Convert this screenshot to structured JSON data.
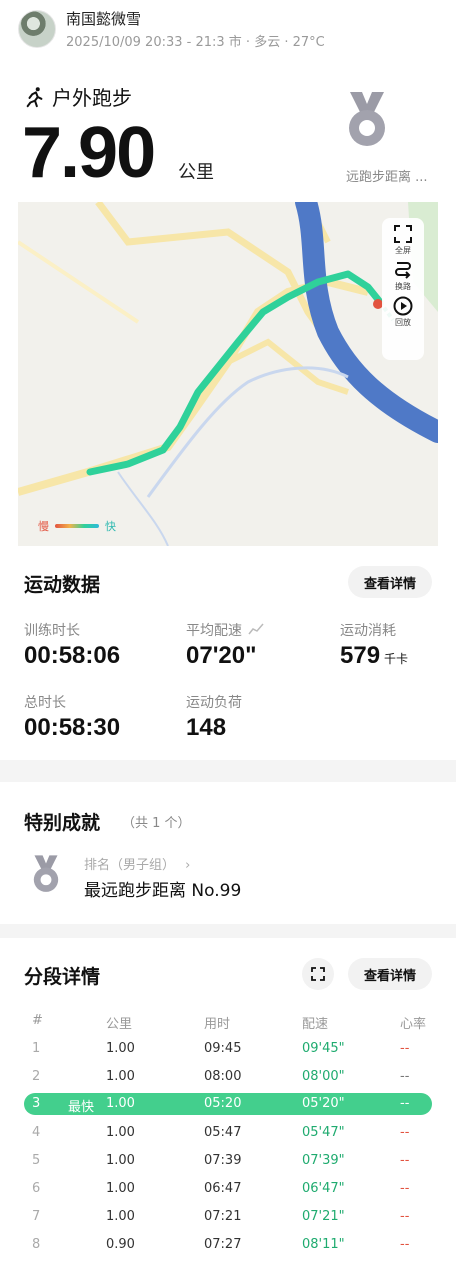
{
  "header": {
    "user_name": "南国懿微雪",
    "meta": "2025/10/09 20:33 - 21:3  市 · 多云 · 27°C"
  },
  "workout": {
    "sport_icon": "running-person-icon",
    "sport_label": "户外跑步",
    "distance": "7.90",
    "distance_unit": "公里",
    "medal_icon": "medal-icon",
    "medal_caption": "远跑步距离 ..."
  },
  "map": {
    "tools": [
      {
        "icon": "fullscreen-icon",
        "label": "全屏"
      },
      {
        "icon": "route-switch-icon",
        "label": "换路"
      },
      {
        "icon": "play-circle-icon",
        "label": "回放"
      }
    ],
    "legend_slow": "慢",
    "legend_fast": "快",
    "colors": {
      "route_fast": "#2fd19a",
      "route_slow": "#e2533f",
      "river": "#4f79c7",
      "road": "#f5dc8f"
    }
  },
  "sport_data": {
    "title": "运动数据",
    "detail_btn": "查看详情",
    "stats": [
      {
        "label": "训练时长",
        "value": "00:58:06",
        "unit": ""
      },
      {
        "label": "平均配速",
        "value": "07'20\"",
        "unit": ""
      },
      {
        "label": "运动消耗",
        "value": "579",
        "unit": "千卡"
      },
      {
        "label": "总时长",
        "value": "00:58:30",
        "unit": ""
      },
      {
        "label": "运动负荷",
        "value": "148",
        "unit": ""
      }
    ]
  },
  "achievement": {
    "title": "特别成就",
    "count": "（共 1 个）",
    "sub": "排名（男子组）",
    "main": "最远跑步距离 No.99"
  },
  "splits": {
    "title": "分段详情",
    "detail_btn": "查看详情",
    "headers": [
      "#",
      "公里",
      "用时",
      "配速",
      "心率"
    ],
    "best_label": "最快",
    "rows": [
      {
        "n": "1",
        "km": "1.00",
        "time": "09:45",
        "pace": "09'45\"",
        "hr": "--"
      },
      {
        "n": "2",
        "km": "1.00",
        "time": "08:00",
        "pace": "08'00\"",
        "hr": "--"
      },
      {
        "n": "3",
        "km": "1.00",
        "time": "05:20",
        "pace": "05'20\"",
        "hr": "--"
      },
      {
        "n": "4",
        "km": "1.00",
        "time": "05:47",
        "pace": "05'47\"",
        "hr": "--"
      },
      {
        "n": "5",
        "km": "1.00",
        "time": "07:39",
        "pace": "07'39\"",
        "hr": "--"
      },
      {
        "n": "6",
        "km": "1.00",
        "time": "06:47",
        "pace": "06'47\"",
        "hr": "--"
      },
      {
        "n": "7",
        "km": "1.00",
        "time": "07:21",
        "pace": "07'21\"",
        "hr": "--"
      },
      {
        "n": "8",
        "km": "0.90",
        "time": "07:27",
        "pace": "08'11\"",
        "hr": "--"
      }
    ]
  }
}
